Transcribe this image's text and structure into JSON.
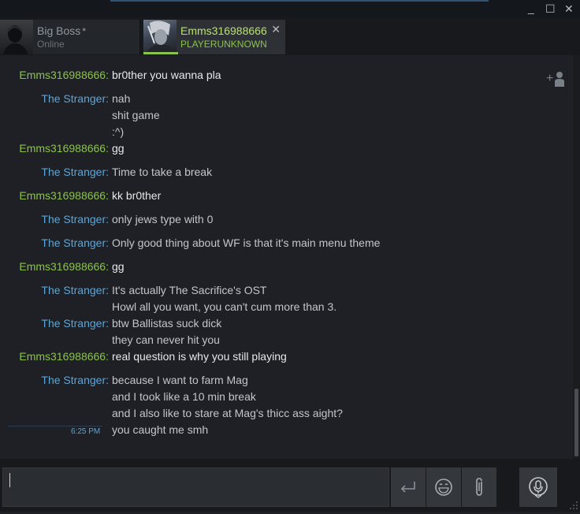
{
  "window": {
    "minimize": "_",
    "maximize": "☐",
    "close": "✕"
  },
  "tabs": [
    {
      "name": "Big Boss",
      "status": "Online",
      "dot": "●"
    },
    {
      "name": "Emms316988666",
      "status": "PLAYERUNKNOWN",
      "close": "✕"
    }
  ],
  "messages": [
    {
      "sender": "Emms316988666:",
      "me": true,
      "lines": [
        "br0ther you wanna pla"
      ]
    },
    {
      "sender": "The Stranger:",
      "me": false,
      "lines": [
        "nah",
        "shit game",
        ":^)"
      ]
    },
    {
      "sender": "Emms316988666:",
      "me": true,
      "lines": [
        "gg"
      ]
    },
    {
      "sender": "The Stranger:",
      "me": false,
      "lines": [
        "Time to take a break"
      ]
    },
    {
      "sender": "Emms316988666:",
      "me": true,
      "lines": [
        "kk br0ther"
      ]
    },
    {
      "sender": "The Stranger:",
      "me": false,
      "lines": [
        "only jews type with 0"
      ]
    },
    {
      "sender": "The Stranger:",
      "me": false,
      "lines": [
        "Only good thing about WF is that it's main menu theme"
      ]
    },
    {
      "sender": "Emms316988666:",
      "me": true,
      "lines": [
        "gg"
      ]
    },
    {
      "sender": "The Stranger:",
      "me": false,
      "lines": [
        "It's actually The Sacrifice's OST",
        "Howl all you want, you can't cum more than 3."
      ]
    },
    {
      "sender": "The Stranger:",
      "me": false,
      "lines": [
        "btw Ballistas suck dick",
        "they can never hit you"
      ]
    },
    {
      "sender": "Emms316988666:",
      "me": true,
      "lines": [
        "real question is why you still playing"
      ]
    },
    {
      "sender": "The Stranger:",
      "me": false,
      "lines": [
        "because I want to farm Mag",
        "and I took like a 10 min break",
        "and I also like to stare at Mag's thicc ass aight?",
        "you caught me smh"
      ]
    }
  ],
  "timestamp": "6:25 PM",
  "colors": {
    "me": "#8bc34a",
    "them": "#5ea5d6",
    "accent_tab": "#8bc34a"
  },
  "icons": {
    "add_user": "add-user-icon",
    "send": "enter-icon",
    "emoji": "emoji-icon",
    "attach": "paperclip-icon",
    "voice": "microphone-icon"
  }
}
